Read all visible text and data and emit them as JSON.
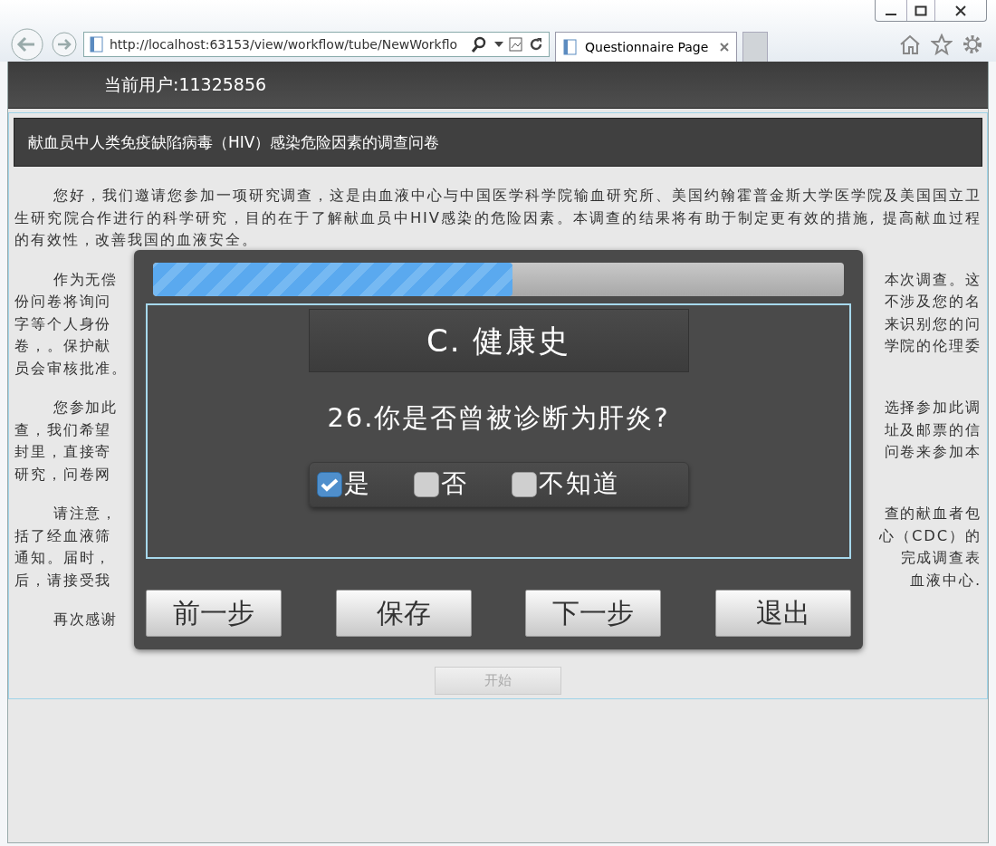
{
  "browser": {
    "address": "http://localhost:63153/view/workflow/tube/NewWorkflo",
    "tabs": [
      {
        "title": "Questionnaire Page",
        "selected": true
      }
    ]
  },
  "header": {
    "user": "当前用户:11325856"
  },
  "survey": {
    "title": "献血员中人类免疫缺陷病毒（HIV）感染危险因素的调查问卷",
    "intro": "您好，我们邀请您参加一项研究调查，这是由血液中心与中国医学科学院输血研究所、美国约翰霍普金斯大学医学院及美国国立卫生研究院合作进行的科学研究，目的在于了解献血员中HIV感染的危险因素。本调查的结果将有助于制定更有效的措施, 提高献血过程的有效性，改善我国的血液安全。",
    "paragraphs": [
      {
        "lines": [
          {
            "left": "作为无偿",
            "right": "本次调查。这"
          },
          {
            "left": "份问卷将询问",
            "right": "不涉及您的名"
          },
          {
            "left": "字等个人身份",
            "right": "来识别您的问"
          },
          {
            "left": "卷，。保护献",
            "right": "学院的伦理委"
          },
          {
            "left": "员会审核批准。"
          }
        ]
      },
      {
        "lines": [
          {
            "left": "您参加此",
            "right": "选择参加此调"
          },
          {
            "left": "查，我们希望",
            "right": "址及邮票的信"
          },
          {
            "left": "封里，直接寄",
            "right": "问卷来参加本"
          },
          {
            "left": "研究，问卷网"
          }
        ]
      },
      {
        "lines": [
          {
            "left": "请注意，",
            "right": "查的献血者包"
          },
          {
            "left": "括了经血液筛",
            "right": "心（CDC）的"
          },
          {
            "left": "通知。届时，",
            "right": "完成调查表"
          },
          {
            "left": "后，请接受我",
            "right": "血液中心."
          }
        ]
      },
      {
        "lines": [
          {
            "left": "再次感谢"
          }
        ]
      }
    ],
    "start_button": {
      "label": "开始",
      "disabled": true
    }
  },
  "dialog": {
    "progress": {
      "level": 0.52
    },
    "section": "C. 健康史",
    "question": "26.你是否曾被诊断为肝炎?",
    "options": [
      {
        "label": "是",
        "checked": true
      },
      {
        "label": "否",
        "checked": false
      },
      {
        "label": "不知道",
        "checked": false
      }
    ],
    "buttons": [
      {
        "label": "前一步"
      },
      {
        "label": "保存"
      },
      {
        "label": "下一步"
      },
      {
        "label": "退出"
      }
    ]
  }
}
